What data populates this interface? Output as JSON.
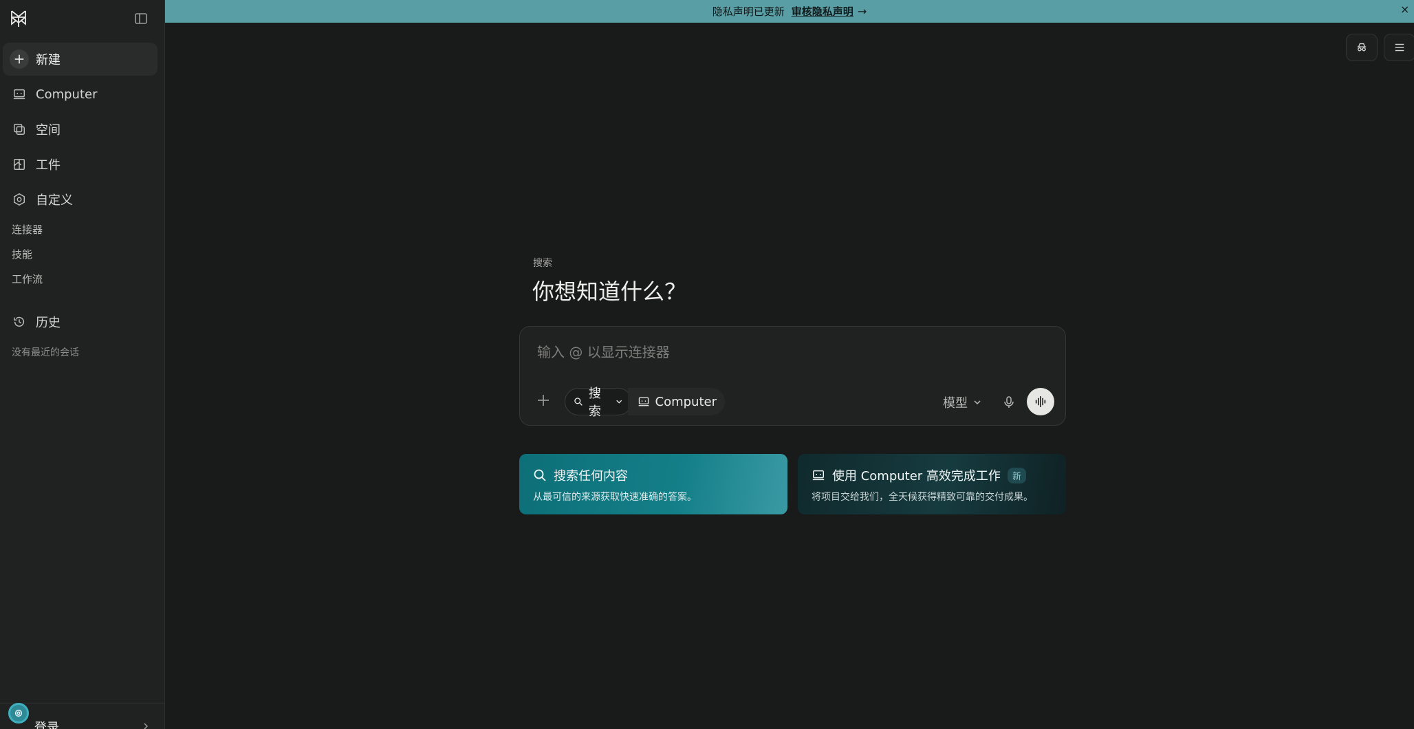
{
  "sidebar": {
    "logo": "perplexity-logo",
    "collapse_icon": "sidebar-toggle-icon",
    "items": [
      {
        "label": "新建",
        "icon": "plus-icon"
      },
      {
        "label": "Computer",
        "icon": "computer-icon"
      },
      {
        "label": "空间",
        "icon": "spaces-icon"
      },
      {
        "label": "工件",
        "icon": "artifact-icon"
      },
      {
        "label": "自定义",
        "icon": "hexagon-icon"
      }
    ],
    "sub_items": [
      "连接器",
      "技能",
      "工作流"
    ],
    "history": {
      "label": "历史",
      "icon": "history-icon",
      "empty": "没有最近的会话"
    },
    "login": {
      "label": "登录"
    }
  },
  "banner": {
    "text": "隐私声明已更新",
    "link": "审核隐私声明",
    "arrow": "→",
    "close": "×"
  },
  "main": {
    "kicker": "搜索",
    "headline": "你想知道什么？",
    "composer": {
      "placeholder": "输入 @ 以显示连接器",
      "search_pill": "搜索",
      "computer_pill": "Computer",
      "model_label": "模型"
    },
    "cards": [
      {
        "title": "搜索任何内容",
        "desc": "从最可信的来源获取快速准确的答案。",
        "icon": "search-icon"
      },
      {
        "title": "使用 Computer 高效完成工作",
        "badge": "新",
        "desc": "将项目交给我们，全天候获得精致可靠的交付成果。",
        "icon": "computer-icon"
      }
    ]
  },
  "colors": {
    "banner": "#5a9ea5",
    "accent": "#147f88",
    "background": "#191a1a",
    "sidebar": "#202222"
  }
}
